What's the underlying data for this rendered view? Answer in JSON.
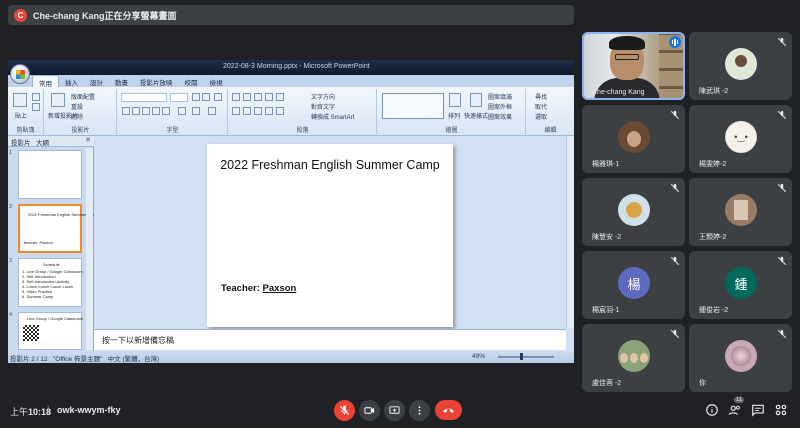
{
  "presenter_bar": {
    "avatar_letter": "C",
    "text": "Che-chang Kang正在分享螢幕畫面",
    "avatar_color": "#e8453c"
  },
  "powerpoint": {
    "window_title": "2022-08-3 Morning.pptx - Microsoft PowerPoint",
    "ribbon_tabs": [
      "常用",
      "插入",
      "設計",
      "動畫",
      "投影片放映",
      "校閱",
      "檢視"
    ],
    "active_tab": "常用",
    "ribbon_groups": [
      "剪貼簿",
      "投影片",
      "字型",
      "段落",
      "繪圖",
      "編輯"
    ],
    "ribbon_items": {
      "paste": "貼上",
      "new_slide": "新增投影片",
      "layout": "版面配置",
      "reset": "重設",
      "delete": "刪除",
      "text_direction": "文字方向",
      "align_text": "對齊文字",
      "smartart": "轉換成 SmartArt",
      "arrange": "排列",
      "quick_styles": "快速樣式",
      "shape_fill": "圖案填滿",
      "shape_outline": "圖案外框",
      "shape_effects": "圖案效果",
      "find": "尋找",
      "replace": "取代",
      "select": "選取"
    },
    "panel_tabs": [
      "投影片",
      "大綱"
    ],
    "thumbnails": [
      {
        "num": "1",
        "lines": []
      },
      {
        "num": "2",
        "lines": [
          "2022 Freshman English Summer Camp",
          "Teacher: Paxson"
        ]
      },
      {
        "num": "3",
        "lines": [
          "Schedule",
          "1. Line Group / Google Classroom",
          "2. Self-Introduction",
          "3. Self-Introduction Activity",
          "4. Lunch Lunch Lunch Lunch",
          "5. Video Practice",
          "6. Summer Camp"
        ]
      },
      {
        "num": "4",
        "lines": [
          "Line Group / Google Classroom"
        ]
      }
    ],
    "slide": {
      "title": "2022 Freshman English Summer Camp",
      "teacher_label": "Teacher: ",
      "teacher_name": "Paxson"
    },
    "notes_placeholder": "按一下以新增備忘稿",
    "status": {
      "slide_pos": "投影片 2 / 12",
      "theme": "\"Office 佈景主題\"",
      "language": "中文 (繁體，台灣)",
      "zoom": "49%"
    }
  },
  "participants": [
    {
      "name": "Che-chang Kang",
      "type": "video",
      "speaking": true
    },
    {
      "name": "陳武琪 -2",
      "type": "photo",
      "avatar_color": "#dfe7d6",
      "muted": true
    },
    {
      "name": "楊雅琪-1",
      "type": "photo",
      "avatar_color": "#6b4a34",
      "muted": true
    },
    {
      "name": "楊雯婷-2",
      "type": "photo",
      "avatar_color": "#f6f0ea",
      "muted": true
    },
    {
      "name": "陳慧安 -2",
      "type": "photo",
      "avatar_color": "#cfe0ea",
      "muted": true
    },
    {
      "name": "王顥婷-2",
      "type": "photo",
      "avatar_color": "#9a7b63",
      "muted": true
    },
    {
      "name": "楊宸羽-1",
      "type": "letter",
      "letter": "楊",
      "avatar_color": "#5c6bc0",
      "muted": true
    },
    {
      "name": "鍾俊岩 -2",
      "type": "letter",
      "letter": "鍾",
      "avatar_color": "#00695c",
      "muted": true
    },
    {
      "name": "盧佳蓉 -2",
      "type": "photo",
      "avatar_color": "#8ba37a",
      "muted": true
    },
    {
      "name": "你",
      "type": "photo",
      "avatar_color": "#c9a8b6",
      "muted": true
    }
  ],
  "bottom_bar": {
    "time_prefix": "上午",
    "time": "10:18",
    "separator": "|",
    "meeting_code": "owk-wwym-fky",
    "participant_count": "11"
  }
}
